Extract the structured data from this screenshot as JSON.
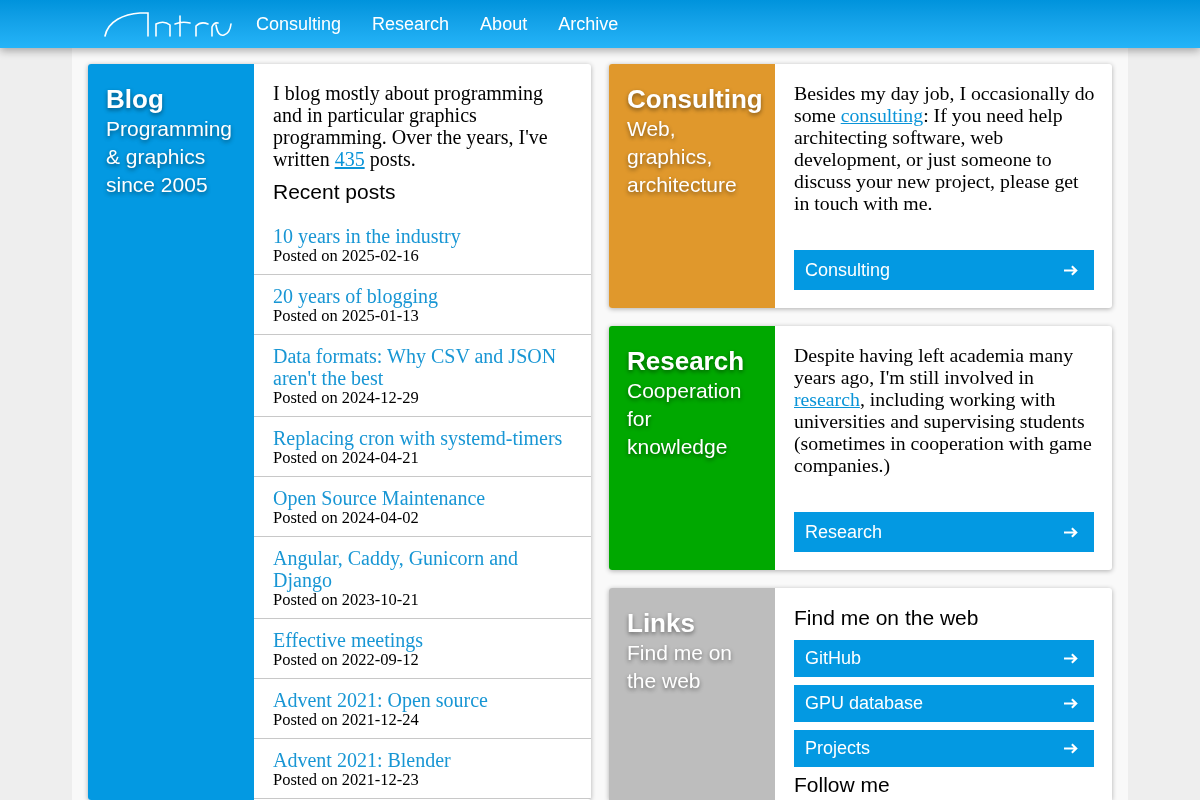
{
  "header": {
    "nav": [
      {
        "label": "Consulting"
      },
      {
        "label": "Research"
      },
      {
        "label": "About"
      },
      {
        "label": "Archive"
      }
    ]
  },
  "cards": [
    {
      "kind": "blog",
      "color": "#0399e2",
      "title": "Blog",
      "subtitle": "Programming & graphics since 2005",
      "intro": {
        "before": "I blog mostly about programming and in particular graphics programming. Over the years, I've written ",
        "link": "435",
        "after": " posts."
      },
      "heading": "Recent posts",
      "posts": [
        {
          "title": "10 years in the industry",
          "date": "Posted on 2025-02-16"
        },
        {
          "title": "20 years of blogging",
          "date": "Posted on 2025-01-13"
        },
        {
          "title": "Data formats: Why CSV and JSON aren't the best",
          "date": "Posted on 2024-12-29"
        },
        {
          "title": "Replacing cron with systemd-timers",
          "date": "Posted on 2024-04-21"
        },
        {
          "title": "Open Source Maintenance",
          "date": "Posted on 2024-04-02"
        },
        {
          "title": "Angular, Caddy, Gunicorn and Django",
          "date": "Posted on 2023-10-21"
        },
        {
          "title": "Effective meetings",
          "date": "Posted on 2022-09-12"
        },
        {
          "title": "Advent 2021: Open source",
          "date": "Posted on 2021-12-24"
        },
        {
          "title": "Advent 2021: Blender",
          "date": "Posted on 2021-12-23"
        }
      ]
    },
    {
      "kind": "text",
      "color": "#e0982c",
      "title": "Consulting",
      "subtitle": "Web, graphics, architecture",
      "body": {
        "before": "Besides my day job, I occasionally do some ",
        "link": "consulting",
        "after": ": If you need help architecting software, web development, or just someone to discuss your new project, please get in touch with me."
      },
      "button": "Consulting"
    },
    {
      "kind": "text",
      "color": "#00a800",
      "title": "Research",
      "subtitle": "Cooperation for knowledge",
      "body": {
        "before": "Despite having left academia many years ago, I'm still involved in ",
        "link": "research",
        "after": ", including working with universities and supervising students (sometimes in cooperation with game companies.)"
      },
      "button": "Research"
    },
    {
      "kind": "links",
      "color": "#bdbdbd",
      "title": "Links",
      "subtitle": "Find me on the web",
      "heading": "Find me on the web",
      "buttons": [
        "GitHub",
        "GPU database",
        "Projects"
      ],
      "heading_2": "Follow me"
    }
  ]
}
